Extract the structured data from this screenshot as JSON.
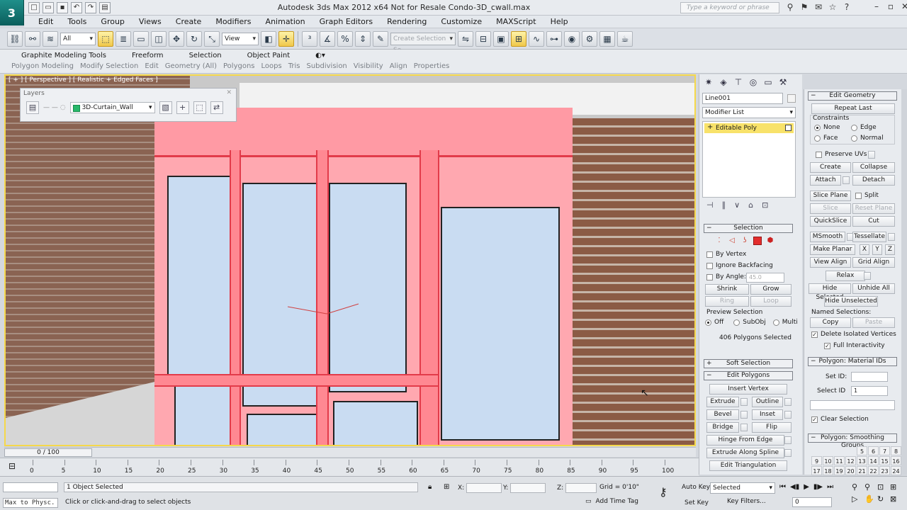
{
  "app": {
    "logo": "3",
    "window_title": "Autodesk 3ds Max  2012 x64    Not for Resale    Condo-3D_cwall.max",
    "search_placeholder": "Type a keyword or phrase"
  },
  "quick_access": [
    "new-icon",
    "open-icon",
    "save-icon",
    "undo-icon",
    "redo-icon",
    "project-icon"
  ],
  "menu": [
    "Edit",
    "Tools",
    "Group",
    "Views",
    "Create",
    "Modifiers",
    "Animation",
    "Graph Editors",
    "Rendering",
    "Customize",
    "MAXScript",
    "Help"
  ],
  "toolbar": {
    "selection_filter": "All",
    "ref_coord": "View",
    "named_selection": "Create Selection Se"
  },
  "ribbon": {
    "tabs": [
      "Graphite Modeling Tools",
      "Freeform",
      "Selection",
      "Object Paint"
    ],
    "subtabs": [
      "Polygon Modeling",
      "Modify Selection",
      "Edit",
      "Geometry (All)",
      "Polygons",
      "Loops",
      "Tris",
      "Subdivision",
      "Visibility",
      "Align",
      "Properties"
    ]
  },
  "viewport": {
    "label": "[ + ] [ Perspective ] [ Realistic + Edged Faces ]"
  },
  "layers": {
    "title": "Layers",
    "current_layer": "3D-Curtain_Wall"
  },
  "command_panel": {
    "object_name": "Line001",
    "modifier_list": "Modifier List",
    "stack_item": "Editable Poly",
    "selection_header": "Selection",
    "by_vertex": "By Vertex",
    "ignore_backfacing": "Ignore Backfacing",
    "by_angle": "By Angle:",
    "by_angle_value": "45.0",
    "shrink": "Shrink",
    "grow": "Grow",
    "ring": "Ring",
    "loop": "Loop",
    "preview_selection": "Preview Selection",
    "preview_off": "Off",
    "preview_subobj": "SubObj",
    "preview_multi": "Multi",
    "poly_count": "406 Polygons Selected",
    "soft_selection": "Soft Selection",
    "edit_polygons": "Edit Polygons",
    "insert_vertex": "Insert Vertex",
    "extrude": "Extrude",
    "outline": "Outline",
    "bevel": "Bevel",
    "inset": "Inset",
    "bridge": "Bridge",
    "flip": "Flip",
    "hinge_from_edge": "Hinge From Edge",
    "extrude_along_spline": "Extrude Along Spline",
    "edit_triangulation": "Edit Triangulation"
  },
  "edit_geometry": {
    "header": "Edit Geometry",
    "repeat_last": "Repeat Last",
    "constraints": "Constraints",
    "none": "None",
    "edge": "Edge",
    "face": "Face",
    "normal": "Normal",
    "preserve_uvs": "Preserve UVs",
    "create": "Create",
    "collapse": "Collapse",
    "attach": "Attach",
    "detach": "Detach",
    "slice_plane": "Slice Plane",
    "split": "Split",
    "slice": "Slice",
    "reset_plane": "Reset Plane",
    "quickslice": "QuickSlice",
    "cut": "Cut",
    "msmooth": "MSmooth",
    "tessellate": "Tessellate",
    "make_planar": "Make Planar",
    "x": "X",
    "y": "Y",
    "z": "Z",
    "view_align": "View Align",
    "grid_align": "Grid Align",
    "relax": "Relax",
    "hide_selected": "Hide Selected",
    "unhide_all": "Unhide All",
    "hide_unselected": "Hide Unselected",
    "named_selections": "Named Selections:",
    "copy": "Copy",
    "paste": "Paste",
    "delete_isolated": "Delete Isolated Vertices",
    "full_interactivity": "Full Interactivity"
  },
  "material_ids": {
    "header": "Polygon: Material IDs",
    "set_id": "Set ID:",
    "select_id": "Select ID",
    "select_id_value": "1",
    "clear_selection": "Clear Selection"
  },
  "smoothing": {
    "header": "Polygon: Smoothing Groups",
    "cells": [
      "",
      "",
      "",
      "",
      "5",
      "6",
      "7",
      "8",
      "9",
      "10",
      "11",
      "12",
      "13",
      "14",
      "15",
      "16",
      "17",
      "18",
      "19",
      "20",
      "21",
      "22",
      "23",
      "24"
    ]
  },
  "timeline": {
    "slider": "0 / 100",
    "marks": [
      "0",
      "5",
      "10",
      "15",
      "20",
      "25",
      "30",
      "35",
      "40",
      "45",
      "50",
      "55",
      "60",
      "65",
      "70",
      "75",
      "80",
      "85",
      "90",
      "95",
      "100"
    ]
  },
  "status": {
    "maxscript": "Max to Physc.",
    "selection": "1 Object Selected",
    "prompt": "Click or click-and-drag to select objects",
    "x_label": "X:",
    "y_label": "Y:",
    "z_label": "Z:",
    "grid": "Grid = 0'10\"",
    "add_time_tag": "Add Time Tag",
    "auto_key": "Auto Key",
    "set_key": "Set Key",
    "selected_combo": "Selected",
    "key_filters": "Key Filters...",
    "frame": "0"
  }
}
